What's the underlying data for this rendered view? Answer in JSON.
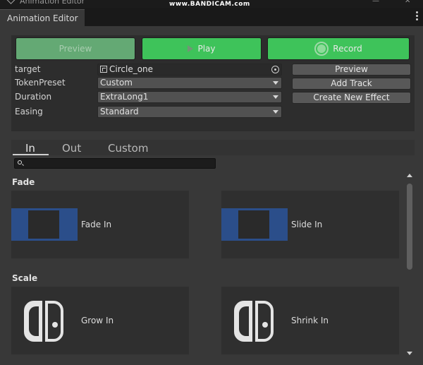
{
  "window": {
    "title": "Animation Editor",
    "watermark": "www.BANDICAM.com",
    "tab_label": "Animation Editor"
  },
  "toolbar": {
    "preview_label": "Preview",
    "play_label": "Play",
    "record_label": "Record"
  },
  "properties": [
    {
      "label": "target",
      "value": "Circle_one"
    },
    {
      "label": "TokenPreset",
      "value": "Custom"
    },
    {
      "label": "Duration",
      "value": "ExtraLong1"
    },
    {
      "label": "Easing",
      "value": "Standard"
    }
  ],
  "side_buttons": {
    "preview": "Preview",
    "add_track": "Add Track",
    "create_effect": "Create New Effect"
  },
  "effect_tabs": [
    {
      "label": "In",
      "active": true
    },
    {
      "label": "Out",
      "active": false
    },
    {
      "label": "Custom",
      "active": false
    }
  ],
  "search": {
    "placeholder": ""
  },
  "sections": [
    {
      "title": "Fade",
      "cards": [
        {
          "label": "Fade In",
          "icon": "fade-thumbnail"
        },
        {
          "label": "Slide In",
          "icon": "slide-thumbnail"
        }
      ]
    },
    {
      "title": "Scale",
      "cards": [
        {
          "label": "Grow In",
          "icon": "switch-controller-icon"
        },
        {
          "label": "Shrink In",
          "icon": "switch-controller-icon"
        }
      ]
    }
  ],
  "colors": {
    "accent_green": "#3ec35a",
    "disabled_green": "#64a974",
    "thumb_blue": "#2b4e8a",
    "panel_bg": "#2d2d2d"
  }
}
